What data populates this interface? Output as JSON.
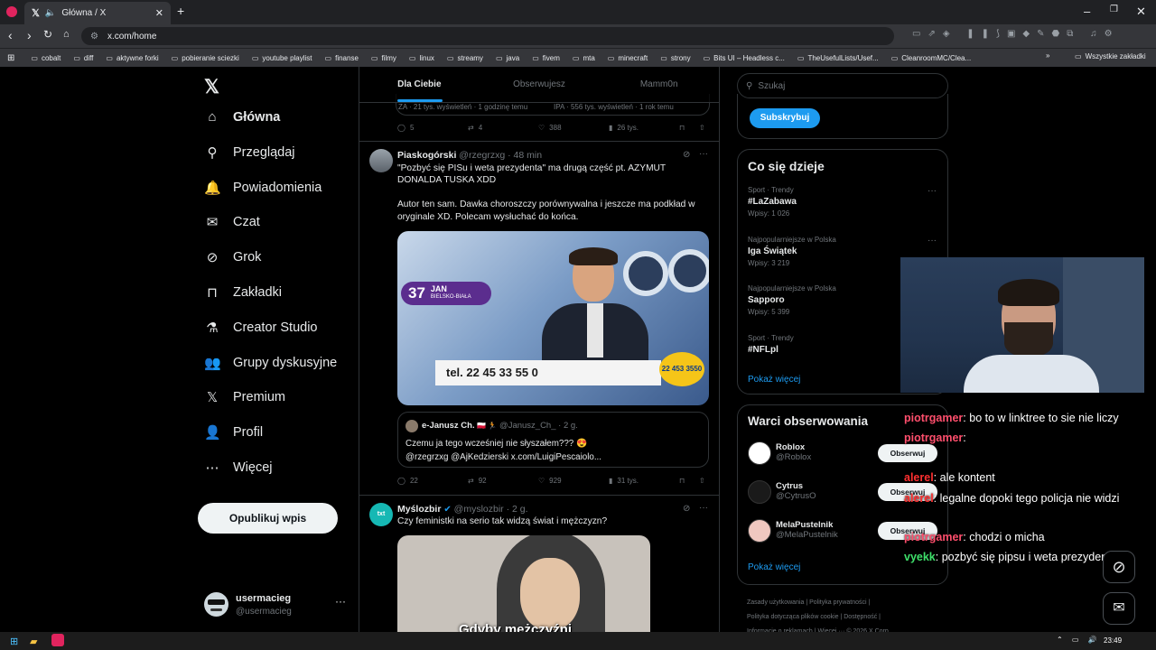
{
  "browser": {
    "tab_title": "Główna / X",
    "url": "x.com/home",
    "bookmarks": [
      "cobalt",
      "diff",
      "aktywne forki",
      "pobieranie sciezki",
      "youtube playlist",
      "finanse",
      "filmy",
      "linux",
      "streamy",
      "java",
      "fivem",
      "mta",
      "minecraft",
      "strony",
      "Bits UI – Headless c...",
      "TheUsefulLists/Usef...",
      "CleanroomMC/Clea..."
    ],
    "all_bookmarks": "Wszystkie zakładki"
  },
  "nav": {
    "items": [
      "Główna",
      "Przeglądaj",
      "Powiadomienia",
      "Czat",
      "Grok",
      "Zakładki",
      "Creator Studio",
      "Grupy dyskusyjne",
      "Premium",
      "Profil",
      "Więcej"
    ],
    "post_button": "Opublikuj wpis",
    "account_name": "usermacieg",
    "account_handle": "@usermacieg"
  },
  "feed": {
    "tabs": [
      "Dla Ciebie",
      "Obserwujesz",
      "Mamm0n"
    ],
    "prev_card_left": "ZA · 21 tys. wyświetleń · 1 godzinę temu",
    "prev_card_right": "IPA · 556 tys. wyświetleń · 1 rok temu",
    "prev_actions": {
      "replies": "5",
      "reposts": "4",
      "likes": "388",
      "views": "26 tys."
    },
    "post1": {
      "name": "Piaskogórski",
      "handle": "@rzegrzxg",
      "time": "· 48 min",
      "text1": "\"Pozbyć się PISu i weta prezydenta\" ma drugą część pt. AZYMUT DONALDA TUSKA XDD",
      "text2": "Autor ten sam. Dawka choroszczy porównywalna i jeszcze ma podkład w oryginale XD. Polecam wysłuchać do końca.",
      "media_badge_num": "37",
      "media_badge_name": "JAN",
      "media_badge_city": "BIELSKO-BIAŁA",
      "media_phone": "tel. 22 45 33 55 0",
      "media_logo_num": "22 453 3550",
      "quote_name": "e-Janusz Ch.",
      "quote_handle": "@Janusz_Ch_",
      "quote_time": "· 2 g.",
      "quote_text1": "Czemu ja tego wcześniej nie słyszałem??? 😍",
      "quote_text2": "@rzegrzxg @AjKedzierski x.com/LuigiPescaiolo...",
      "actions": {
        "replies": "22",
        "reposts": "92",
        "likes": "929",
        "views": "31 tys."
      }
    },
    "post2": {
      "name": "Myślozbir",
      "handle": "@myslozbir",
      "time": "· 2 g.",
      "text": "Czy feministki na serio tak widzą świat i mężczyzn?",
      "caption": "Gdyby mężczyźni"
    }
  },
  "right": {
    "search_placeholder": "Szukaj",
    "subscribe": "Subskrybuj",
    "trends_title": "Co się dzieje",
    "trends": [
      {
        "meta": "Sport · Trendy",
        "name": "#LaZabawa",
        "count": "Wpisy: 1 026"
      },
      {
        "meta": "Najpopularniejsze w Polska",
        "name": "Iga Świątek",
        "count": "Wpisy: 3 219"
      },
      {
        "meta": "Najpopularniejsze w Polska",
        "name": "Sapporo",
        "count": "Wpisy: 5 399"
      },
      {
        "meta": "Sport · Trendy",
        "name": "#NFLpl",
        "count": ""
      }
    ],
    "show_more": "Pokaż więcej",
    "who_title": "Warci obserwowania",
    "who": [
      {
        "name": "Roblox",
        "handle": "@Roblox"
      },
      {
        "name": "Cytrus",
        "handle": "@CytrusO"
      },
      {
        "name": "MelaPustelnik",
        "handle": "@MelaPustelnik"
      }
    ],
    "follow": "Obserwuj",
    "show_more2": "Pokaż więcej",
    "footer1": "Zasady użytkowania | Polityka prywatności |",
    "footer2": "Polityka dotycząca plików cookie | Dostępność |",
    "footer3": "Informacje o reklamach | Więcej ··· © 2026 X Corp."
  },
  "chat": [
    {
      "user": "piotrgamer",
      "color": "#ff4f6d",
      "text": ": bo to w linktree to sie nie liczy"
    },
    {
      "user": "piotrgamer",
      "color": "#ff4f6d",
      "text": ":"
    },
    {
      "user": "alerel",
      "color": "#ff3030",
      "text": ": ale kontent"
    },
    {
      "user": "alerel",
      "color": "#ff3030",
      "text": ": legalne dopoki tego policja nie widzi"
    },
    {
      "user": "piotrgamer",
      "color": "#ff4f6d",
      "text": ": chodzi o micha"
    },
    {
      "user": "vyekk",
      "color": "#3ee06a",
      "text": ": pozbyć się pipsu i weta prezydenta"
    }
  ],
  "taskbar": {
    "time": "23:49"
  }
}
